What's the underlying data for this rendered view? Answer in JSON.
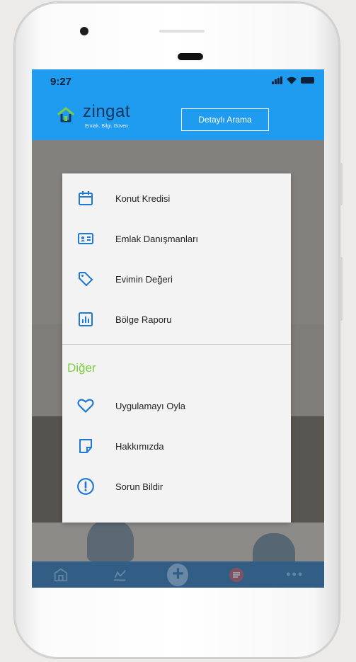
{
  "status_bar": {
    "time": "9:27"
  },
  "header": {
    "logo_text": "zingat",
    "logo_tagline": "Emlak. Bilgi. Güven.",
    "search_button_label": "Detaylı Arama"
  },
  "menu": {
    "items": [
      {
        "label": "Konut Kredisi",
        "icon": "calendar-icon"
      },
      {
        "label": "Emlak Danışmanları",
        "icon": "contact-card-icon"
      },
      {
        "label": "Evimin Değeri",
        "icon": "price-tag-icon"
      },
      {
        "label": "Bölge Raporu",
        "icon": "bar-chart-icon"
      }
    ],
    "other_section_label": "Diğer",
    "other_items": [
      {
        "label": "Uygulamayı Oyla",
        "icon": "heart-icon"
      },
      {
        "label": "Hakkımızda",
        "icon": "note-icon"
      },
      {
        "label": "Sorun Bildir",
        "icon": "alert-circle-icon"
      }
    ]
  },
  "bottom_nav": {
    "items": [
      "home-icon",
      "checklist-icon",
      "add-icon",
      "message-icon",
      "more-icon"
    ]
  },
  "colors": {
    "brand_blue": "#1f9bf0",
    "icon_blue": "#1e78d6",
    "accent_green": "#7cd03a",
    "nav_dark": "#325e86"
  }
}
